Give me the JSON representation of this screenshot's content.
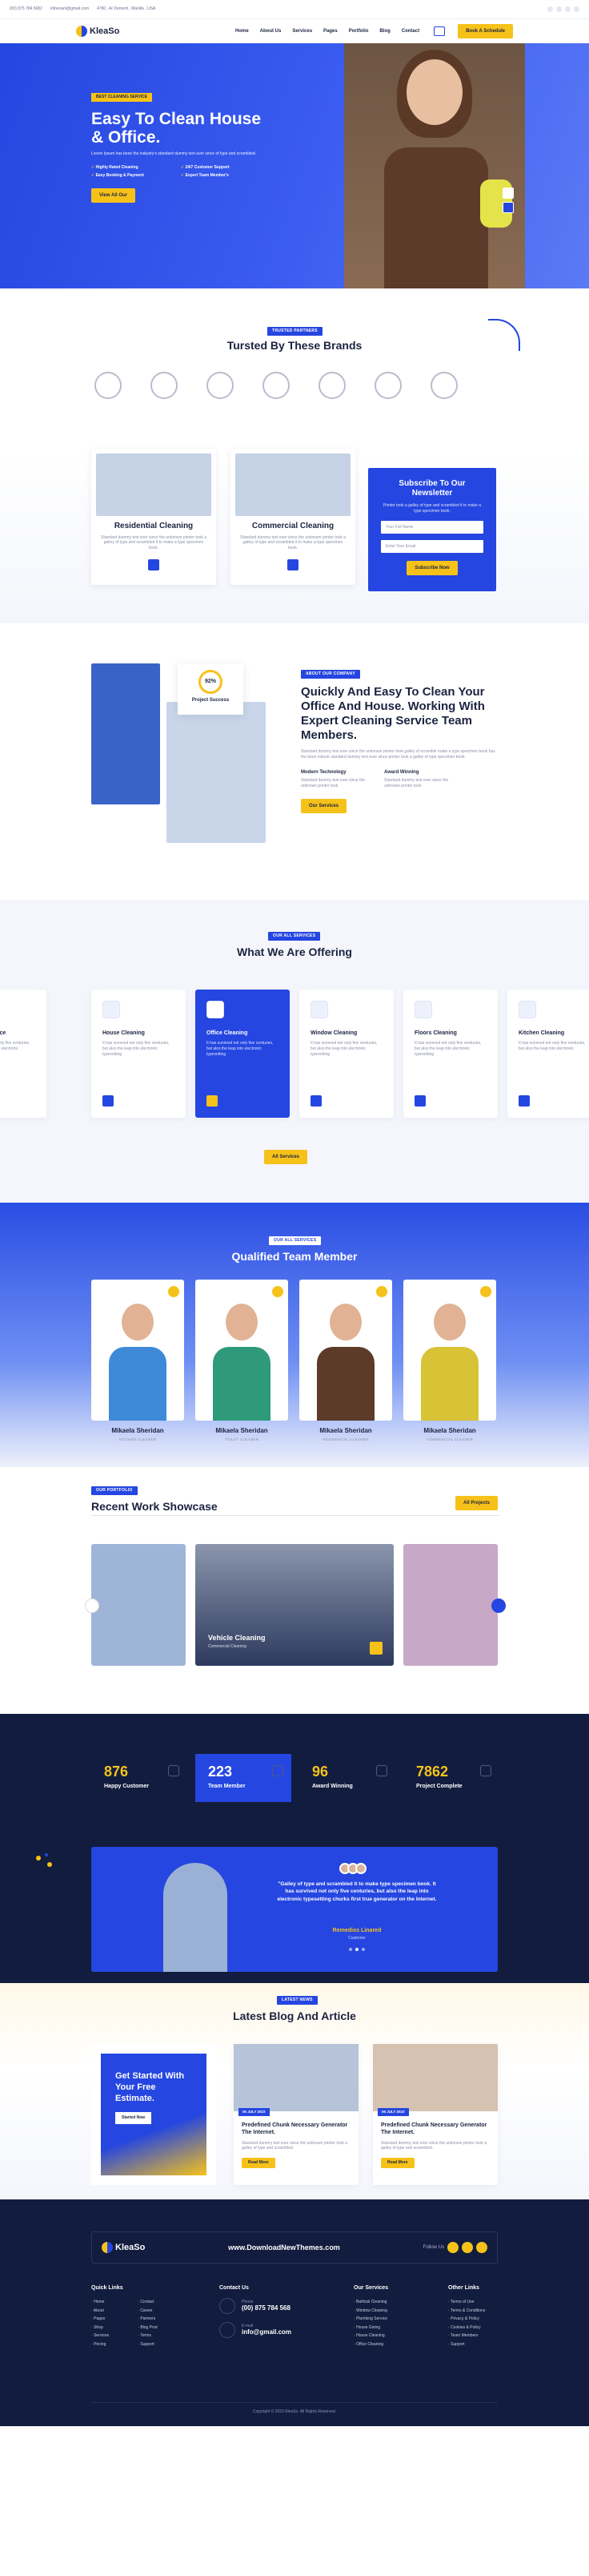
{
  "topbar": {
    "phone": "(00) 875 784 5682",
    "email": "infoexam@gmail.com",
    "address": "4780 , Ar Demerit , Manilla , USA"
  },
  "nav": {
    "logo": "KleaSo",
    "items": [
      "Home",
      "About Us",
      "Services",
      "Pages",
      "Portfolio",
      "Blog",
      "Contact"
    ],
    "cta": "Book A Schedule"
  },
  "hero": {
    "tag": "BEST CLEANING SERVICE",
    "title": "Easy To Clean House & Office.",
    "text": "Lorem Ipsum has been the industry's standard dummy text ever since of type and scrambled.",
    "features": [
      "Highly Rated Cleaning",
      "24/7 Customer Support",
      "Easy Booking & Payment",
      "Expert Team Member's"
    ],
    "cta": "View All Our"
  },
  "brands": {
    "tag": "TRUSTED PARTNERS",
    "title": "Tursted By These Brands"
  },
  "services_row": {
    "cards": [
      {
        "title": "Residential Cleaning",
        "text": "Standard dummy text ever since the unknown printer took a galley of type and scrambled it to make a type specimen book."
      },
      {
        "title": "Commercial Cleaning",
        "text": "Standard dummy text ever since the unknown printer took a galley of type and scrambled it to make a type specimen book."
      }
    ],
    "newsletter": {
      "title": "Subscribe To Our Newsletter",
      "text": "Printer took a galley of type and scrambled it to make a type specimen book.",
      "name_placeholder": "Your Full Name",
      "email_placeholder": "Enter Your Email",
      "button": "Subscribe Now"
    }
  },
  "about": {
    "progress_value": "92%",
    "progress_label": "Project Success",
    "tag": "ABOUT OUR COMPANY",
    "title": "Quickly And Easy To Clean Your Office And House. Working With Expert Cleaning Service Team Members.",
    "text": "Standard dummy text ever since the unknown printer took galley of scramble make a type specimen book has the been industr standard dummy text ever since printer took a galley of type specimen book.",
    "features": [
      {
        "title": "Modern Technology",
        "text": "Standard dummy text ever since the unknown printer took"
      },
      {
        "title": "Award Winning",
        "text": "Standard dummy text ever since the unknown printer took"
      }
    ],
    "button": "Our Services"
  },
  "offering": {
    "tag": "OUR ALL SERVICES",
    "title": "What We Are Offering",
    "button": "All Services",
    "cards": [
      {
        "title": "Roofing Service",
        "text": "It has survived not only five centuries, but also the leap into electronic"
      },
      {
        "title": "House Cleaning",
        "text": "It has survived not only five centuries, but also the leap into electronic typesetting"
      },
      {
        "title": "Office Cleaning",
        "text": "It has survived not only five centuries, but also the leap into electronic typesetting"
      },
      {
        "title": "Window Cleaning",
        "text": "It has survived not only five centuries, but also the leap into electronic typesetting"
      },
      {
        "title": "Floors Cleaning",
        "text": "It has survived not only five centuries, but also the leap into electronic typesetting"
      },
      {
        "title": "Kitchen Cleaning",
        "text": "It has survived not only five centuries, but also the leap into electronic"
      }
    ]
  },
  "team": {
    "tag": "OUR ALL SERVICES",
    "title": "Qualified Team Member",
    "members": [
      {
        "name": "Mikaela Sheridan",
        "role": "KITCHEN CLEANER"
      },
      {
        "name": "Mikaela Sheridan",
        "role": "TOILET CLEANER"
      },
      {
        "name": "Mikaela Sheridan",
        "role": "RESIDENTIAL CLEANER"
      },
      {
        "name": "Mikaela Sheridan",
        "role": "COMMERCIAL CLEANER"
      }
    ]
  },
  "work": {
    "tag": "OUR PORTFOLIO",
    "title": "Recent Work Showcase",
    "button": "All Projects",
    "featured_title": "Vehicle Cleaning",
    "featured_sub": "Commercial Cleaning"
  },
  "stats": [
    {
      "value": "876",
      "label": "Happy Customer"
    },
    {
      "value": "223",
      "label": "Team Member"
    },
    {
      "value": "96",
      "label": "Award Winning"
    },
    {
      "value": "7862",
      "label": "Project Complete"
    }
  ],
  "testimonial": {
    "quote": "\"Galley of type and scrambled it to make type specimen book. It has survived not only five centuries, but also the leap into electronic typesetting churks first true generator on the Internet.",
    "name": "Remedios Linared",
    "role": "Customer"
  },
  "blog": {
    "tag": "LATEST NEWS",
    "title": "Latest Blog And Article",
    "promo_title": "Get Started With Your Free Estimate.",
    "promo_button": "Started Now",
    "posts": [
      {
        "date": "05 JULY 2023",
        "title": "Predefined Chunk Necessary Generator The Internet.",
        "text": "Standard dummy text ever since the unknown printer took a galley of type and scrambled.",
        "button": "Read More"
      },
      {
        "date": "05 JULY 2023",
        "title": "Predefined Chunk Necessary Generator The Internet.",
        "text": "Standard dummy text ever since the unknown printer took a galley of type and scrambled.",
        "button": "Read More"
      }
    ]
  },
  "footer": {
    "logo": "KleaSo",
    "site": "www.DownloadNewThemes.com",
    "follow": "Follow Us",
    "quick_title": "Quick Links",
    "quick_col1": [
      "Home",
      "About",
      "Pages",
      "Shop",
      "Services",
      "Pricing"
    ],
    "quick_col2": [
      "Contact",
      "Career",
      "Partners",
      "Blog Post",
      "Terms",
      "Support"
    ],
    "contact_title": "Contact Us",
    "phone_label": "Phone",
    "phone": "(00) 875 784 568",
    "email_label": "E-mail",
    "email": "info@gmail.com",
    "services_title": "Our Services",
    "services": [
      "Bathtub Cleaning",
      "Window Cleaning",
      "Plumbing Service",
      "House Giving",
      "House Cleaning",
      "Office Cleaning"
    ],
    "other_title": "Other Links",
    "other": [
      "Terms of Use",
      "Terms & Conditions",
      "Privacy & Policy",
      "Cookies & Policy",
      "Team Members",
      "Support"
    ],
    "copyright": "Copyright © 2023 KleaSo. All Rights Reserved."
  }
}
